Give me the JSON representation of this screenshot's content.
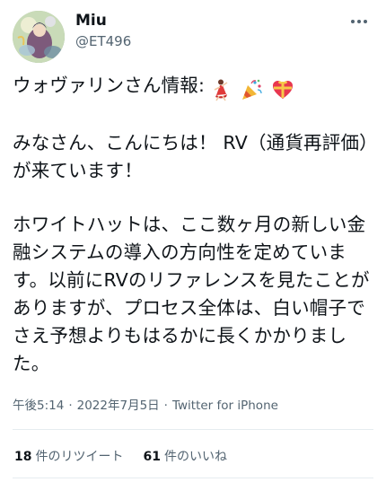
{
  "user": {
    "display_name": "Miu",
    "handle": "@ET496",
    "avatar_icon": "avatar-image"
  },
  "tweet": {
    "line1": "ウォヴァリンさん情報:",
    "line1_emojis": [
      "dancer-emoji",
      "party-popper-emoji",
      "heart-gift-emoji"
    ],
    "paragraph2": "みなさん、こんにちは！ RV（通貨再評価）が来ています！",
    "paragraph3": "ホワイトハットは、ここ数ヶ月の新しい金融システムの導入の方向性を定めています。以前にRVのリファレンスを見たことがありますが、プロセス全体は、白い帽子でさえ予想よりもはるかに長くかかりました。"
  },
  "meta": {
    "time": "午後5:14",
    "date": "2022年7月5日",
    "client": "Twitter for iPhone",
    "separator": "·"
  },
  "stats": {
    "retweets_count": "18",
    "retweets_label": "件のリツイート",
    "likes_count": "61",
    "likes_label": "件のいいね"
  },
  "colors": {
    "text": "#0f1419",
    "muted": "#536471",
    "divider": "#e6ecf0"
  }
}
